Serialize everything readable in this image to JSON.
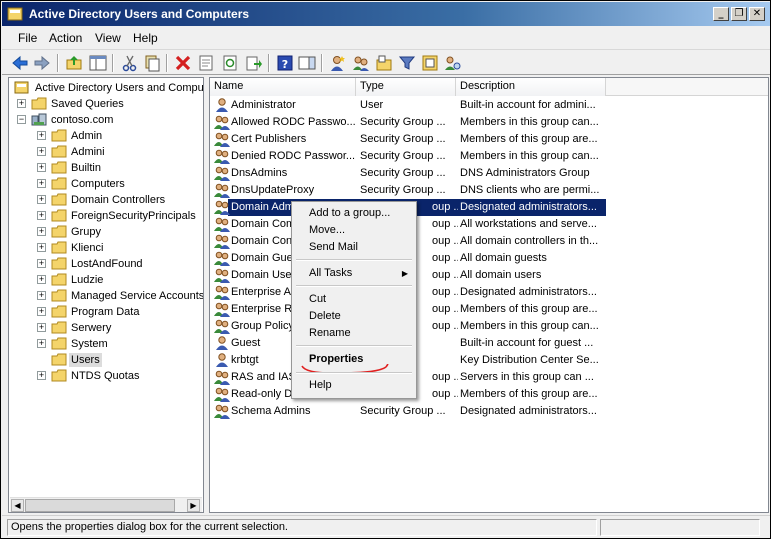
{
  "window": {
    "title": "Active Directory Users and Computers",
    "controls": {
      "minimize": "_",
      "restore": "❐",
      "close": "✕"
    }
  },
  "menubar": {
    "items": [
      "File",
      "Action",
      "View",
      "Help"
    ]
  },
  "toolbar": {
    "icons": [
      "back-arrow-icon",
      "forward-arrow-icon",
      "up-folder-icon",
      "show-console-tree-icon",
      "cut-icon",
      "copy-icon",
      "delete-icon",
      "properties-icon",
      "refresh-icon",
      "export-list-icon",
      "help-icon",
      "action-pane-icon",
      "new-user-icon",
      "new-group-icon",
      "new-ou-icon",
      "filter-icon",
      "add-to-group-icon",
      "delegate-icon"
    ]
  },
  "tree": {
    "root": "Active Directory Users and Comput",
    "items": [
      {
        "label": "Saved Queries",
        "level": 1,
        "expander": "+"
      },
      {
        "label": "contoso.com",
        "level": 1,
        "expander": "−"
      },
      {
        "label": "Admin",
        "level": 2,
        "expander": "+"
      },
      {
        "label": "Admini",
        "level": 2,
        "expander": "+"
      },
      {
        "label": "Builtin",
        "level": 2,
        "expander": "+"
      },
      {
        "label": "Computers",
        "level": 2,
        "expander": "+"
      },
      {
        "label": "Domain Controllers",
        "level": 2,
        "expander": "+"
      },
      {
        "label": "ForeignSecurityPrincipals",
        "level": 2,
        "expander": "+"
      },
      {
        "label": "Grupy",
        "level": 2,
        "expander": "+"
      },
      {
        "label": "Klienci",
        "level": 2,
        "expander": "+"
      },
      {
        "label": "LostAndFound",
        "level": 2,
        "expander": "+"
      },
      {
        "label": "Ludzie",
        "level": 2,
        "expander": "+"
      },
      {
        "label": "Managed Service Accounts",
        "level": 2,
        "expander": "+"
      },
      {
        "label": "Program Data",
        "level": 2,
        "expander": "+"
      },
      {
        "label": "Serwery",
        "level": 2,
        "expander": "+"
      },
      {
        "label": "System",
        "level": 2,
        "expander": "+"
      },
      {
        "label": "Users",
        "level": 2,
        "expander": "",
        "selected": true
      },
      {
        "label": "NTDS Quotas",
        "level": 2,
        "expander": "+"
      }
    ]
  },
  "list": {
    "columns": [
      "Name",
      "Type",
      "Description"
    ],
    "rows": [
      {
        "name": "Administrator",
        "type": "User",
        "desc": "Built-in account for admini...",
        "icon": "user"
      },
      {
        "name": "Allowed RODC Passwo...",
        "type": "Security Group ...",
        "desc": "Members in this group can...",
        "icon": "group"
      },
      {
        "name": "Cert Publishers",
        "type": "Security Group ...",
        "desc": "Members of this group are...",
        "icon": "group"
      },
      {
        "name": "Denied RODC Passwor...",
        "type": "Security Group ...",
        "desc": "Members in this group can...",
        "icon": "group"
      },
      {
        "name": "DnsAdmins",
        "type": "Security Group ...",
        "desc": "DNS Administrators Group",
        "icon": "group"
      },
      {
        "name": "DnsUpdateProxy",
        "type": "Security Group ...",
        "desc": "DNS clients who are permi...",
        "icon": "group"
      },
      {
        "name": "Domain Adm",
        "type": "oup ...",
        "desc": "Designated administrators...",
        "icon": "group",
        "selected": true
      },
      {
        "name": "Domain Com",
        "type": "oup ...",
        "desc": "All workstations and serve...",
        "icon": "group"
      },
      {
        "name": "Domain Cont",
        "type": "oup ...",
        "desc": "All domain controllers in th...",
        "icon": "group"
      },
      {
        "name": "Domain Gues",
        "type": "oup ...",
        "desc": "All domain guests",
        "icon": "group"
      },
      {
        "name": "Domain User",
        "type": "oup ...",
        "desc": "All domain users",
        "icon": "group"
      },
      {
        "name": "Enterprise A",
        "type": "oup ...",
        "desc": "Designated administrators...",
        "icon": "group"
      },
      {
        "name": "Enterprise R",
        "type": "oup ...",
        "desc": "Members of this group are...",
        "icon": "group"
      },
      {
        "name": "Group Policy",
        "type": "oup ...",
        "desc": "Members in this group can...",
        "icon": "group"
      },
      {
        "name": "Guest",
        "type": "",
        "desc": "Built-in account for guest ...",
        "icon": "user"
      },
      {
        "name": "krbtgt",
        "type": "",
        "desc": "Key Distribution Center Se...",
        "icon": "user"
      },
      {
        "name": "RAS and IAS",
        "type": "oup ...",
        "desc": "Servers in this group can ...",
        "icon": "group"
      },
      {
        "name": "Read-only Domain Contr...",
        "type": "oup ...",
        "desc": "Members of this group are...",
        "icon": "group"
      },
      {
        "name": "Schema Admins",
        "type": "Security Group ...",
        "desc": "Designated administrators...",
        "icon": "group"
      }
    ]
  },
  "context_menu": {
    "items": [
      "Add to a group...",
      "Move...",
      "Send Mail",
      "All Tasks",
      "Cut",
      "Delete",
      "Rename",
      "Properties",
      "Help"
    ],
    "submenu_arrow": "▶"
  },
  "statusbar": {
    "text": "Opens the properties dialog box for the current selection."
  },
  "colors": {
    "selection": "#0a246a",
    "annotation": "#e02020"
  }
}
